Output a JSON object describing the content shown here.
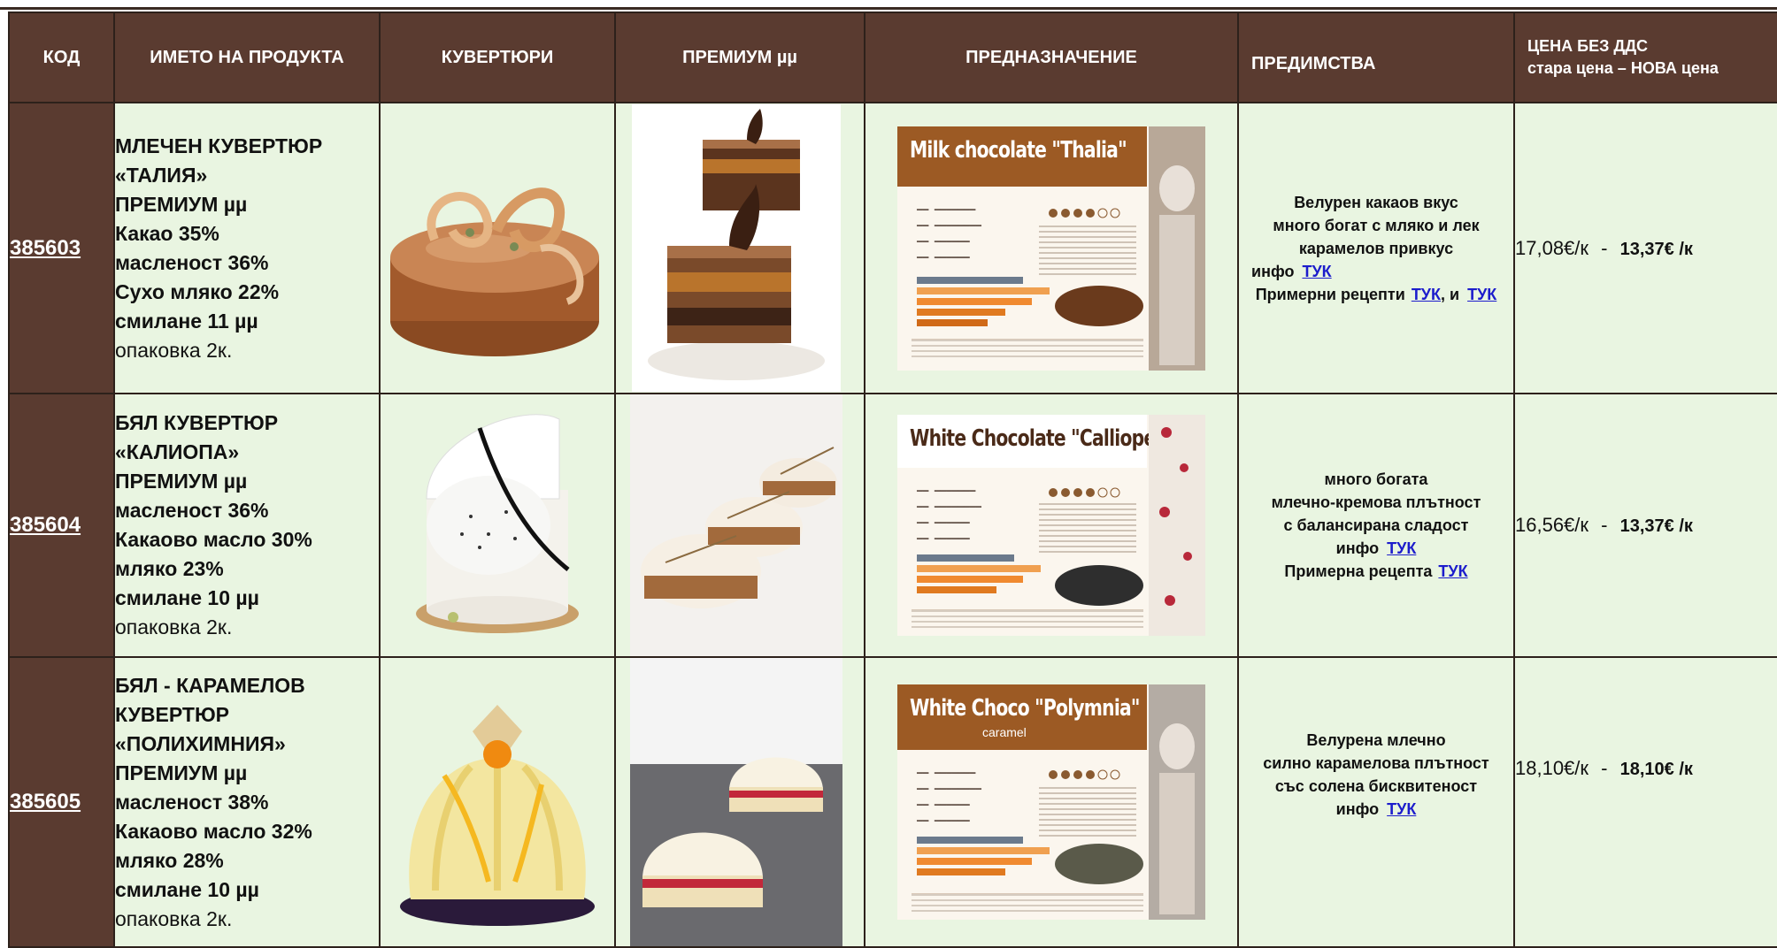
{
  "header": {
    "code": "КОД",
    "product_name": "ИМЕТО НА ПРОДУКТА",
    "couvertures": "КУВЕРТЮРИ",
    "premium": "ПРЕМИУМ µµ",
    "purpose": "ПРЕДНАЗНАЧЕНИЕ",
    "benefits": "ПРЕДИМСТВА",
    "price_line1": "ЦЕНА  БЕЗ ДДС",
    "price_line2": "стара цена – НОВА цена"
  },
  "colors": {
    "header_bg": "#5a3b30",
    "row_bg": "#e9f5e1",
    "link": "#1c1ccc"
  },
  "products": [
    {
      "code": "385603",
      "name_lines": [
        "МЛЕЧЕН КУВЕРТЮР",
        "«ТАЛИЯ»",
        "ПРЕМИУМ µµ",
        "Какао 35%",
        "масленост 36%",
        "Сухо мляко 22%",
        "смилане 11 µµ"
      ],
      "packaging": "опаковка 2к.",
      "card_title": "Milk chocolate \"Thalia\"",
      "card_subtitle": "",
      "benefit_lines": [
        "Велурен какаов вкус",
        "много богат с мляко и лек",
        "карамелов привкус"
      ],
      "info_label": "инфо",
      "info_link": "ТУК",
      "recipe_label": "Примерни рецепти",
      "recipe_link1": "ТУК",
      "recipe_sep": ", и",
      "recipe_link2": "ТУК",
      "old_price": "17,08€/к",
      "price_sep": "-",
      "new_price": "13,37€ /к"
    },
    {
      "code": "385604",
      "name_lines": [
        "БЯЛ КУВЕРТЮР",
        "«КАЛИОПА»",
        "ПРЕМИУМ µµ",
        "масленост 36%",
        "Какаово масло 30%",
        "мляко 23%",
        "смилане 10 µµ"
      ],
      "packaging": "опаковка 2к.",
      "card_title": "White Chocolate \"Calliope\"",
      "card_subtitle": "",
      "benefit_lines": [
        "много богата",
        "млечно-кремова плътност",
        "с балансирана сладост"
      ],
      "info_label": "инфо",
      "info_link": "ТУК",
      "recipe_label": "Примерна рецепта",
      "recipe_link1": "ТУК",
      "old_price": "16,56€/к",
      "price_sep": "-",
      "new_price": "13,37€ /к"
    },
    {
      "code": "385605",
      "name_lines": [
        "БЯЛ - КАРАМЕЛОВ",
        "КУВЕРТЮР",
        "«ПОЛИХИМНИЯ»",
        "ПРЕМИУМ µµ",
        "масленост 38%",
        "Какаово масло 32%",
        "мляко 28%",
        "смилане 10 µµ"
      ],
      "packaging": "опаковка 2к.",
      "card_title": "White Choco \"Polymnia\"",
      "card_subtitle": "caramel",
      "benefit_lines": [
        "Велурена млечно",
        "силно карамелова плътност",
        "със солена бисквитеност"
      ],
      "info_label": "инфо",
      "info_link": "ТУК",
      "old_price": "18,10€/к",
      "price_sep": "-",
      "new_price": "18,10€ /к"
    }
  ]
}
